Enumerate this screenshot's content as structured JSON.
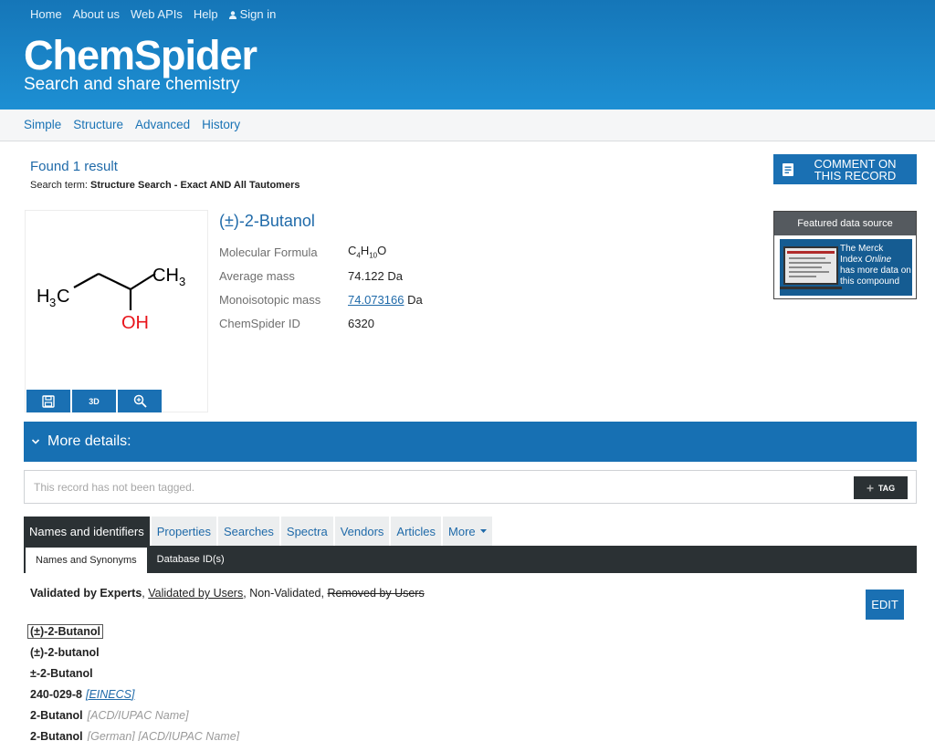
{
  "topnav": {
    "items": [
      "Home",
      "About us",
      "Web APIs",
      "Help"
    ],
    "sign_in": "Sign in"
  },
  "brand": {
    "logo": "ChemSpider",
    "tagline": "Search and share chemistry"
  },
  "subnav": {
    "items": [
      "Simple",
      "Structure",
      "Advanced",
      "History"
    ]
  },
  "results": {
    "found": "Found 1 result",
    "search_term_label": "Search term:",
    "search_term_value": "Structure Search - Exact AND All Tautomers"
  },
  "comment_button": {
    "line1": "COMMENT ON",
    "line2": "THIS RECORD"
  },
  "structure": {
    "atoms": {
      "left_methyl": "H",
      "left_sub": "3",
      "left_c": "C",
      "right": "CH",
      "right_sub": "3",
      "oh": "OH"
    },
    "tools": {
      "save_icon": "save-icon",
      "view3d": "3D",
      "zoom_icon": "zoom-icon"
    }
  },
  "compound": {
    "title": "(±)-2-Butanol",
    "props": [
      {
        "key": "Molecular Formula",
        "value": "C4H10O"
      },
      {
        "key": "Average mass",
        "value": "74.122 Da"
      },
      {
        "key": "Monoisotopic mass",
        "value_link": "74.073166",
        "value_suffix": "Da"
      },
      {
        "key": "ChemSpider ID",
        "value": "6320"
      }
    ],
    "formula_parts": {
      "c": "C",
      "c_sub": "4",
      "h": "H",
      "h_sub": "10",
      "o": "O"
    }
  },
  "featured": {
    "header": "Featured data source",
    "text_1": "The Merck",
    "text_2": "Index",
    "text_online": "Online",
    "text_3": "has more data on",
    "text_4": "this compound"
  },
  "more_details": {
    "label": "More details:"
  },
  "tagging": {
    "message": "This record has not been tagged.",
    "tag_button": "TAG"
  },
  "tabs": {
    "items": [
      "Names and identifiers",
      "Properties",
      "Searches",
      "Spectra",
      "Vendors",
      "Articles",
      "More"
    ],
    "active": 0
  },
  "subtabs": {
    "items": [
      "Names and Synonyms",
      "Database ID(s)"
    ],
    "active": 0
  },
  "legend": {
    "experts": "Validated by Experts",
    "sep1": ", ",
    "users": "Validated by Users",
    "sep2": ", ",
    "nonvalidated": "Non-Validated",
    "sep3": ", ",
    "removed": "Removed by Users"
  },
  "edit_button": "EDIT",
  "names": [
    {
      "name": "(±)-2-Butanol",
      "boxed": true
    },
    {
      "name": "(±)-2-butanol"
    },
    {
      "name": "±-2-Butanol"
    },
    {
      "name": "240-029-8",
      "link": "[EINECS]"
    },
    {
      "name": "2-Butanol",
      "ref": "[ACD/IUPAC Name]"
    },
    {
      "name": "2-Butanol",
      "ref": "[German] [ACD/IUPAC Name]"
    }
  ],
  "colors": {
    "header_blue": "#1a84c7",
    "primary_button": "#1a70b3",
    "link_blue": "#1f6aa9",
    "dark_tab": "#2b3134",
    "oh_red": "#e8141b"
  }
}
